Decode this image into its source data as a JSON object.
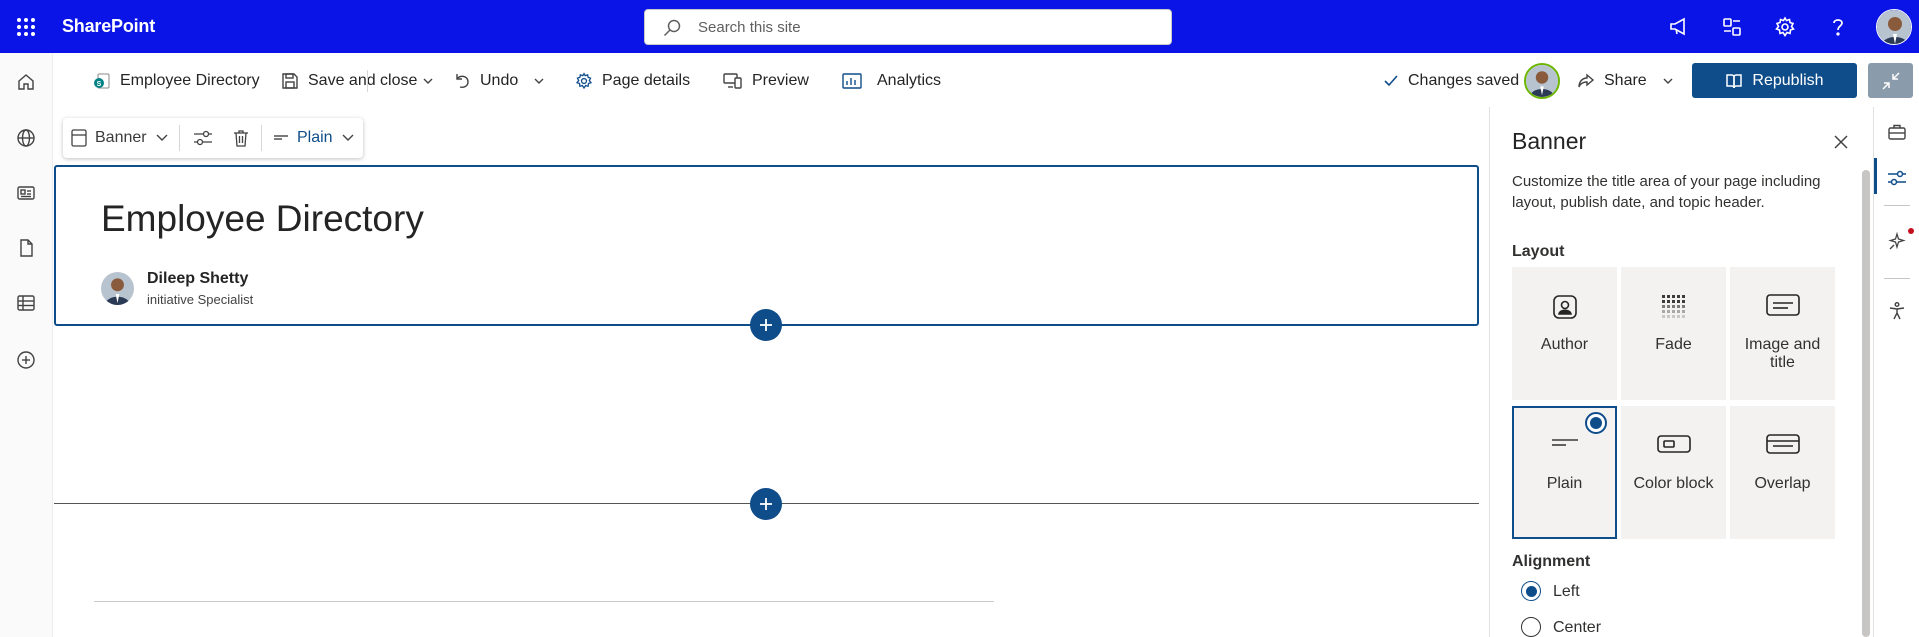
{
  "suitebar": {
    "app_name": "SharePoint",
    "search_placeholder": "Search this site",
    "icons": [
      "waffle-icon",
      "megaphone-icon",
      "feedback-icon",
      "gear-icon",
      "help-icon"
    ],
    "background": "#0a14e6"
  },
  "leftrail": {
    "items": [
      "home-icon",
      "globe-icon",
      "news-icon",
      "document-icon",
      "list-icon",
      "add-circle-icon"
    ]
  },
  "commandbar": {
    "page_name": "Employee Directory",
    "save_label": "Save and close",
    "undo_label": "Undo",
    "page_details_label": "Page details",
    "preview_label": "Preview",
    "analytics_label": "Analytics",
    "status_label": "Changes saved",
    "share_label": "Share",
    "republish_label": "Republish",
    "accent": "#0f4d8a"
  },
  "toolbar": {
    "banner_label": "Banner",
    "layout_label": "Plain"
  },
  "banner": {
    "title": "Employee Directory",
    "author_name": "Dileep Shetty",
    "author_title": "initiative Specialist"
  },
  "pane": {
    "title": "Banner",
    "description": "Customize the title area of your page including layout, publish date, and topic header.",
    "layout_label": "Layout",
    "layouts": [
      {
        "label": "Author",
        "selected": false
      },
      {
        "label": "Fade",
        "selected": false
      },
      {
        "label": "Image and title",
        "selected": false
      },
      {
        "label": "Plain",
        "selected": true
      },
      {
        "label": "Color block",
        "selected": false
      },
      {
        "label": "Overlap",
        "selected": false
      }
    ],
    "alignment_label": "Alignment",
    "alignment_options": [
      {
        "label": "Left",
        "checked": true
      },
      {
        "label": "Center",
        "checked": false
      }
    ]
  },
  "rightrail": {
    "items": [
      "toolbox-icon",
      "settings-sliders-icon",
      "design-ideas-icon",
      "accessibility-icon"
    ]
  }
}
